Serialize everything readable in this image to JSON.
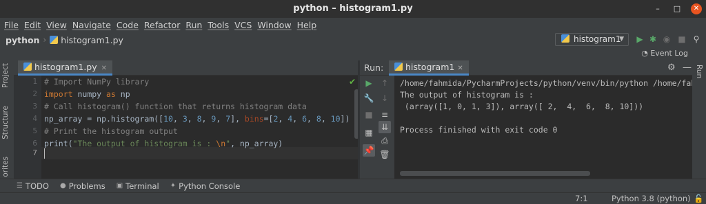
{
  "window": {
    "title": "python – histogram1.py",
    "controls": {
      "minimize": "–",
      "maximize": "□",
      "close": "✕"
    }
  },
  "menu": [
    "File",
    "Edit",
    "View",
    "Navigate",
    "Code",
    "Refactor",
    "Run",
    "Tools",
    "VCS",
    "Window",
    "Help"
  ],
  "navbar": {
    "project": "python",
    "file": "histogram1.py",
    "run_config": "histogram1"
  },
  "event_log": "Event Log",
  "side_labels": {
    "project": "Project",
    "structure": "Structure",
    "favorites": "orites",
    "run": "Run"
  },
  "editor": {
    "tab_label": "histogram1.py",
    "line_numbers": [
      "1",
      "2",
      "3",
      "4",
      "5",
      "6",
      "7"
    ],
    "lines": {
      "l1": "# Import NumPy library",
      "l2_kw": "import",
      "l2_mod": " numpy ",
      "l2_as": "as",
      "l2_alias": " np",
      "l3": "# Call histogram() function that returns histogram data",
      "l4_a": "np_array = np.histogram([",
      "l4_n1": "10",
      "l4_sep1": ", ",
      "l4_n2": "3",
      "l4_sep2": ", ",
      "l4_n3": "8",
      "l4_sep3": ", ",
      "l4_n4": "9",
      "l4_sep4": ", ",
      "l4_n5": "7",
      "l4_b": "], ",
      "l4_param": "bins",
      "l4_c": "=[",
      "l4_b1": "2",
      "l4_bs1": ", ",
      "l4_b2": "4",
      "l4_bs2": ", ",
      "l4_b3": "6",
      "l4_bs3": ", ",
      "l4_b4": "8",
      "l4_bs4": ", ",
      "l4_b5": "10",
      "l4_d": "])",
      "l5": "# Print the histogram output",
      "l6_fn": "print(",
      "l6_str1": "\"The output of histogram is : ",
      "l6_esc": "\\n",
      "l6_str2": "\"",
      "l6_rest": ", np_array)"
    }
  },
  "run_panel": {
    "label": "Run:",
    "tab": "histogram1",
    "console": [
      "/home/fahmida/PycharmProjects/python/venv/bin/python /home/fahmida/",
      "The output of histogram is :",
      " (array([1, 0, 1, 3]), array([ 2,  4,  6,  8, 10]))",
      "",
      "Process finished with exit code 0"
    ]
  },
  "bottom_tools": [
    "TODO",
    "Problems",
    "Terminal",
    "Python Console"
  ],
  "status": {
    "position": "7:1",
    "interpreter": "Python 3.8 (python)"
  },
  "colors": {
    "accent": "#4a88c7",
    "run_green": "#59a869",
    "close": "#e95420"
  }
}
